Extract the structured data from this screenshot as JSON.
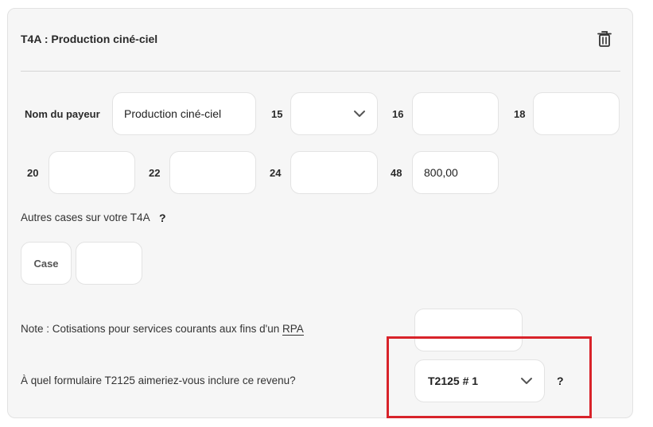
{
  "card": {
    "title": "T4A : Production ciné-ciel",
    "delete_icon": "trash-icon"
  },
  "row1": {
    "payer_label": "Nom du payeur",
    "payer_value": "Production ciné-ciel",
    "box15_label": "15",
    "box15_value": "",
    "box16_label": "16",
    "box16_value": "",
    "box18_label": "18",
    "box18_value": ""
  },
  "row2": {
    "box20_label": "20",
    "box20_value": "",
    "box22_label": "22",
    "box22_value": "",
    "box24_label": "24",
    "box24_value": "",
    "box48_label": "48",
    "box48_value": "800,00"
  },
  "other": {
    "label": "Autres cases sur votre T4A",
    "help": "?",
    "case_button": "Case",
    "case_value": ""
  },
  "note": {
    "prefix": "Note : Cotisations pour services courants aux fins d'un ",
    "rpa": "RPA",
    "value": ""
  },
  "t2125": {
    "question": "À quel formulaire T2125 aimeriez-vous inclure ce revenu?",
    "selected": "T2125 # 1",
    "help": "?"
  },
  "colors": {
    "highlight": "#d8232a",
    "card_bg": "#f6f6f6"
  }
}
